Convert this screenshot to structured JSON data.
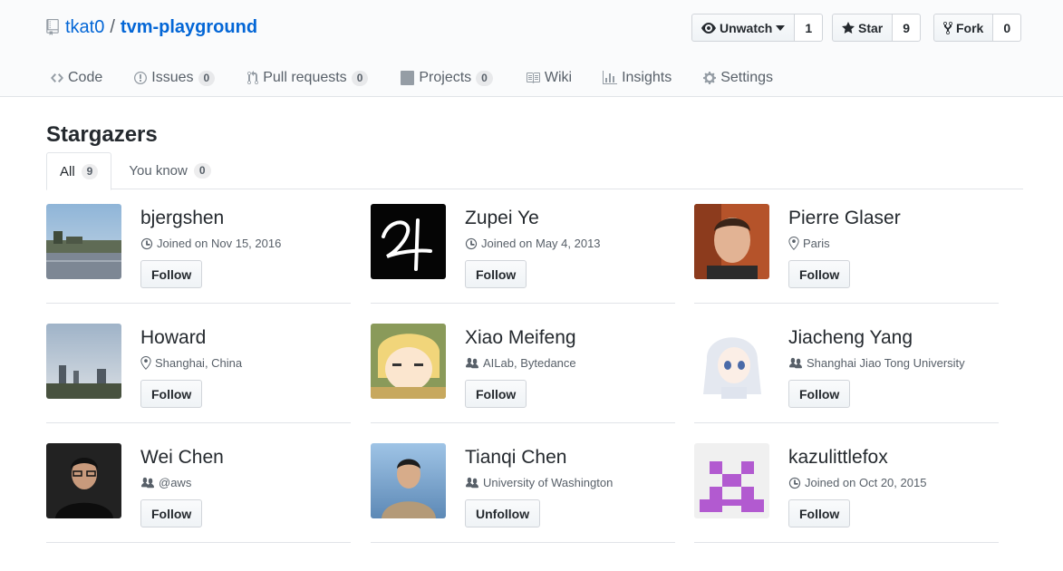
{
  "repo": {
    "owner": "tkat0",
    "separator": "/",
    "name": "tvm-playground"
  },
  "actions": {
    "watch": {
      "label": "Unwatch",
      "count": "1"
    },
    "star": {
      "label": "Star",
      "count": "9"
    },
    "fork": {
      "label": "Fork",
      "count": "0"
    }
  },
  "nav": [
    {
      "label": "Code",
      "icon": "code-icon"
    },
    {
      "label": "Issues",
      "count": "0",
      "icon": "issue-icon"
    },
    {
      "label": "Pull requests",
      "count": "0",
      "icon": "pull-request-icon"
    },
    {
      "label": "Projects",
      "count": "0",
      "icon": "project-icon"
    },
    {
      "label": "Wiki",
      "icon": "book-icon"
    },
    {
      "label": "Insights",
      "icon": "graph-icon"
    },
    {
      "label": "Settings",
      "icon": "gear-icon"
    }
  ],
  "page": {
    "title": "Stargazers"
  },
  "tabs": [
    {
      "label": "All",
      "count": "9"
    },
    {
      "label": "You know",
      "count": "0"
    }
  ],
  "users": [
    {
      "name": "bjergshen",
      "meta": "Joined on Nov 15, 2016",
      "meta_icon": "clock-icon",
      "button": "Follow"
    },
    {
      "name": "Zupei Ye",
      "meta": "Joined on May 4, 2013",
      "meta_icon": "clock-icon",
      "button": "Follow"
    },
    {
      "name": "Pierre Glaser",
      "meta": "Paris",
      "meta_icon": "location-icon",
      "button": "Follow"
    },
    {
      "name": "Howard",
      "meta": "Shanghai, China",
      "meta_icon": "location-icon",
      "button": "Follow"
    },
    {
      "name": "Xiao Meifeng",
      "meta": "AILab, Bytedance",
      "meta_icon": "organization-icon",
      "button": "Follow"
    },
    {
      "name": "Jiacheng Yang",
      "meta": "Shanghai Jiao Tong University",
      "meta_icon": "organization-icon",
      "button": "Follow"
    },
    {
      "name": "Wei Chen",
      "meta": "@aws",
      "meta_icon": "organization-icon",
      "button": "Follow"
    },
    {
      "name": "Tianqi Chen",
      "meta": "University of Washington",
      "meta_icon": "organization-icon",
      "button": "Unfollow"
    },
    {
      "name": "kazulittlefox",
      "meta": "Joined on Oct 20, 2015",
      "meta_icon": "clock-icon",
      "button": "Follow"
    }
  ]
}
